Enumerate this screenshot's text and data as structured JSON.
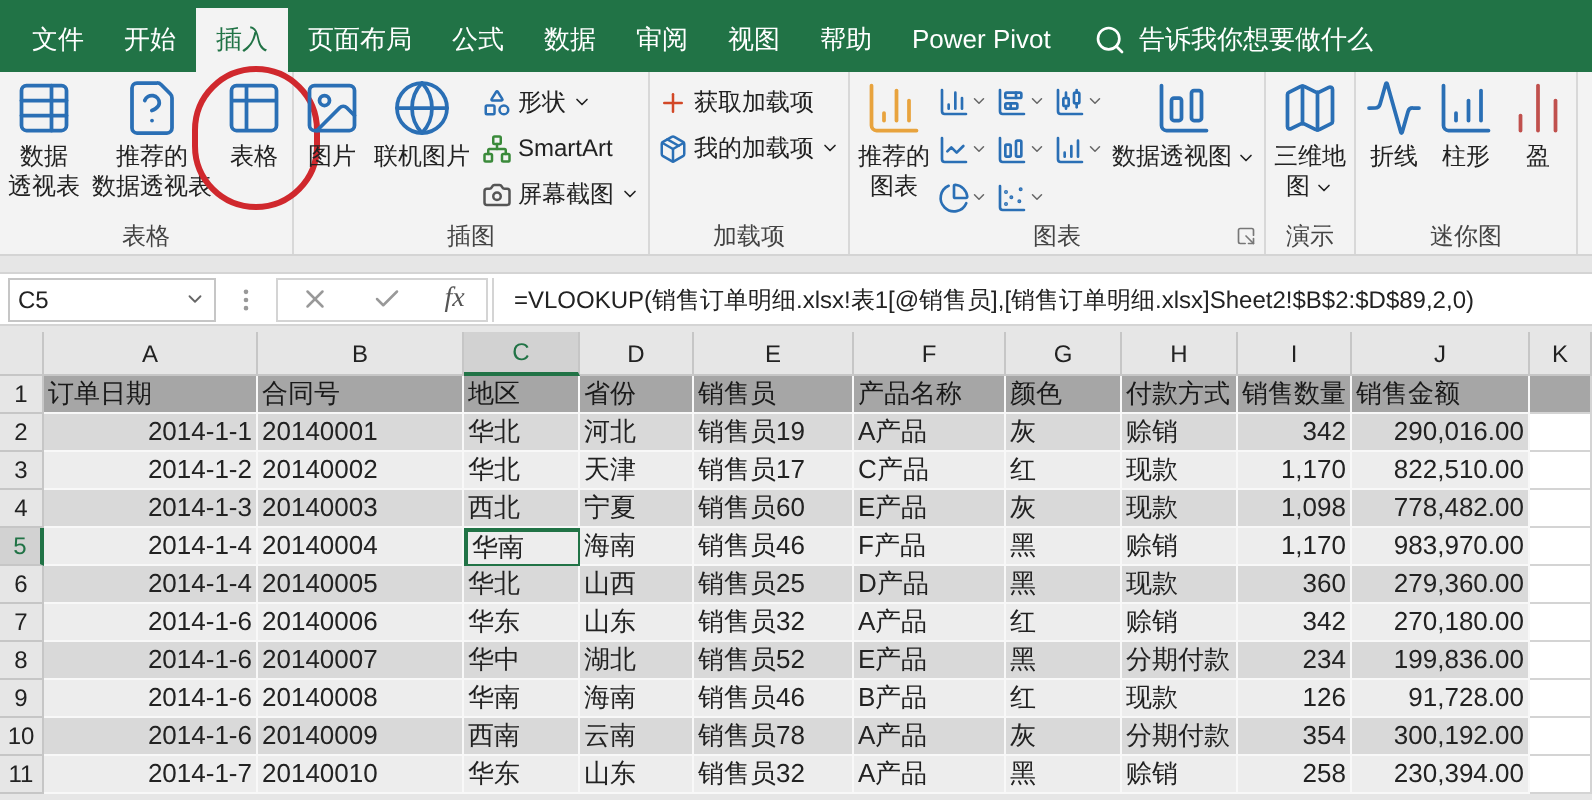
{
  "tabs": [
    {
      "label": "文件",
      "selected": false
    },
    {
      "label": "开始",
      "selected": false
    },
    {
      "label": "插入",
      "selected": true
    },
    {
      "label": "页面布局",
      "selected": false
    },
    {
      "label": "公式",
      "selected": false
    },
    {
      "label": "数据",
      "selected": false
    },
    {
      "label": "审阅",
      "selected": false
    },
    {
      "label": "视图",
      "selected": false
    },
    {
      "label": "帮助",
      "selected": false
    },
    {
      "label": "Power Pivot",
      "selected": false
    }
  ],
  "search": {
    "placeholder": "告诉我你想要做什么"
  },
  "ribbon": {
    "groups": [
      {
        "label": "表格",
        "launcher": false,
        "items": [
          {
            "kind": "large",
            "label": "数据透视表",
            "dropdown": false,
            "highlighted": false
          },
          {
            "kind": "large",
            "label": "推荐的数据透视表",
            "dropdown": false,
            "highlighted": false
          },
          {
            "kind": "large",
            "label": "表格",
            "dropdown": false,
            "highlighted": true
          }
        ]
      },
      {
        "label": "插图",
        "launcher": false,
        "items": [
          {
            "kind": "large",
            "label": "图片",
            "dropdown": false,
            "highlighted": false
          },
          {
            "kind": "large",
            "label": "联机图片",
            "dropdown": false,
            "highlighted": false
          },
          {
            "kind": "stack",
            "entries": [
              {
                "label": "形状",
                "dropdown": true
              },
              {
                "label": "SmartArt",
                "dropdown": false
              },
              {
                "label": "屏幕截图",
                "dropdown": true
              }
            ]
          }
        ]
      },
      {
        "label": "加载项",
        "launcher": false,
        "items": [
          {
            "kind": "stack",
            "entries": [
              {
                "label": "获取加载项",
                "dropdown": false
              },
              {
                "label": "我的加载项",
                "dropdown": true
              }
            ]
          }
        ]
      },
      {
        "label": "图表",
        "launcher": true,
        "items": [
          {
            "kind": "large",
            "label": "推荐的图表",
            "dropdown": false,
            "highlighted": false
          },
          {
            "kind": "gallery"
          },
          {
            "kind": "large",
            "label": "数据透视图",
            "dropdown": true,
            "highlighted": false
          }
        ]
      },
      {
        "label": "演示",
        "launcher": false,
        "items": [
          {
            "kind": "large",
            "label": "三维地图",
            "dropdown": true,
            "highlighted": false
          }
        ]
      },
      {
        "label": "迷你图",
        "launcher": false,
        "items": [
          {
            "kind": "large",
            "label": "折线",
            "dropdown": false,
            "highlighted": false
          },
          {
            "kind": "large",
            "label": "柱形",
            "dropdown": false,
            "highlighted": false
          },
          {
            "kind": "large",
            "label": "盈",
            "dropdown": false,
            "highlighted": false
          }
        ]
      }
    ]
  },
  "formula_bar": {
    "name_box": "C5",
    "function_label": "fx",
    "formula": "=VLOOKUP(销售订单明细.xlsx!表1[@销售员],[销售订单明细.xlsx]Sheet2!$B$2:$D$89,2,0)"
  },
  "sheet": {
    "columns": [
      {
        "label": "A",
        "selected": false
      },
      {
        "label": "B",
        "selected": false
      },
      {
        "label": "C",
        "selected": true
      },
      {
        "label": "D",
        "selected": false
      },
      {
        "label": "E",
        "selected": false
      },
      {
        "label": "F",
        "selected": false
      },
      {
        "label": "G",
        "selected": false
      },
      {
        "label": "H",
        "selected": false
      },
      {
        "label": "I",
        "selected": false
      },
      {
        "label": "J",
        "selected": false
      },
      {
        "label": "K",
        "selected": false
      }
    ],
    "rows": [
      {
        "number": "1",
        "selected": false,
        "cells": [
          "订单日期",
          "合同号",
          "地区",
          "省份",
          "销售员",
          "产品名称",
          "颜色",
          "付款方式",
          "销售数量",
          "销售金额"
        ]
      },
      {
        "number": "2",
        "selected": false,
        "cells": [
          "2014-1-1",
          "20140001",
          "华北",
          "河北",
          "销售员19",
          "A产品",
          "灰",
          "赊销",
          "342",
          "290,016.00"
        ]
      },
      {
        "number": "3",
        "selected": false,
        "cells": [
          "2014-1-2",
          "20140002",
          "华北",
          "天津",
          "销售员17",
          "C产品",
          "红",
          "现款",
          "1,170",
          "822,510.00"
        ]
      },
      {
        "number": "4",
        "selected": false,
        "cells": [
          "2014-1-3",
          "20140003",
          "西北",
          "宁夏",
          "销售员60",
          "E产品",
          "灰",
          "现款",
          "1,098",
          "778,482.00"
        ]
      },
      {
        "number": "5",
        "selected": true,
        "cells": [
          "2014-1-4",
          "20140004",
          "华南",
          "海南",
          "销售员46",
          "F产品",
          "黑",
          "赊销",
          "1,170",
          "983,970.00"
        ]
      },
      {
        "number": "6",
        "selected": false,
        "cells": [
          "2014-1-4",
          "20140005",
          "华北",
          "山西",
          "销售员25",
          "D产品",
          "黑",
          "现款",
          "360",
          "279,360.00"
        ]
      },
      {
        "number": "7",
        "selected": false,
        "cells": [
          "2014-1-6",
          "20140006",
          "华东",
          "山东",
          "销售员32",
          "A产品",
          "红",
          "赊销",
          "342",
          "270,180.00"
        ]
      },
      {
        "number": "8",
        "selected": false,
        "cells": [
          "2014-1-6",
          "20140007",
          "华中",
          "湖北",
          "销售员52",
          "E产品",
          "黑",
          "分期付款",
          "234",
          "199,836.00"
        ]
      },
      {
        "number": "9",
        "selected": false,
        "cells": [
          "2014-1-6",
          "20140008",
          "华南",
          "海南",
          "销售员46",
          "B产品",
          "红",
          "现款",
          "126",
          "91,728.00"
        ]
      },
      {
        "number": "10",
        "selected": false,
        "cells": [
          "2014-1-6",
          "20140009",
          "西南",
          "云南",
          "销售员78",
          "A产品",
          "灰",
          "分期付款",
          "354",
          "300,192.00"
        ]
      },
      {
        "number": "11",
        "selected": false,
        "cells": [
          "2014-1-7",
          "20140010",
          "华东",
          "山东",
          "销售员32",
          "A产品",
          "黑",
          "赊销",
          "258",
          "230,394.00"
        ]
      }
    ]
  }
}
